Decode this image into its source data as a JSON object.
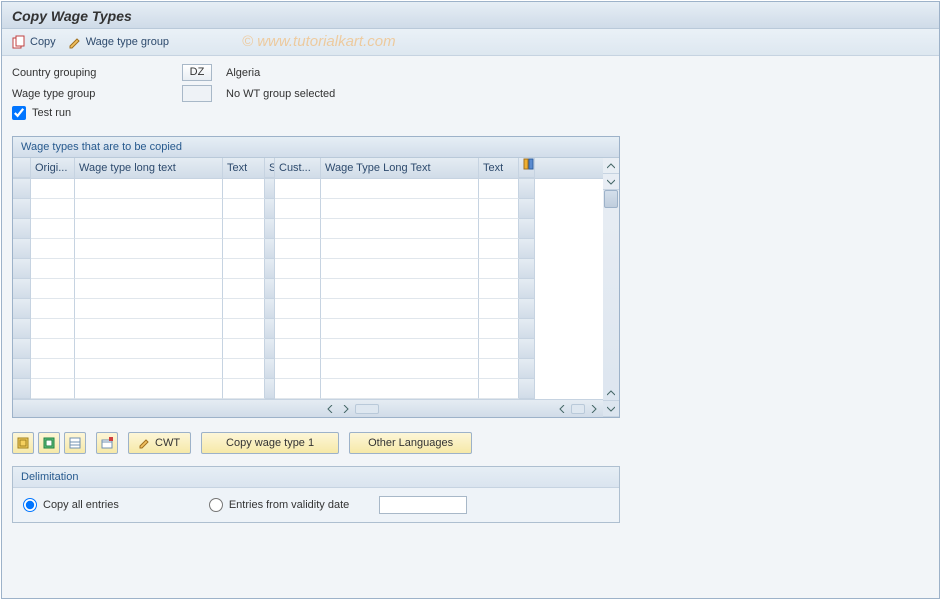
{
  "title": "Copy Wage Types",
  "toolbar": {
    "copy_label": "Copy",
    "wtg_label": "Wage type group"
  },
  "watermark": "©  www.tutorialkart.com",
  "form": {
    "country_grouping_label": "Country grouping",
    "country_grouping_value": "DZ",
    "country_grouping_desc": "Algeria",
    "wtg_label": "Wage type group",
    "wtg_value": "",
    "wtg_desc": "No WT group selected",
    "test_run_label": "Test run",
    "test_run_checked": true
  },
  "grid": {
    "title": "Wage types that are to be copied",
    "columns": [
      "Origi...",
      "Wage type long text",
      "Text",
      "S",
      "Cust...",
      "Wage Type Long Text",
      "Text"
    ],
    "row_count": 11
  },
  "buttons": {
    "cwt_label": "CWT",
    "copy_wt1_label": "Copy wage type 1",
    "other_lang_label": "Other Languages"
  },
  "delimitation": {
    "legend": "Delimitation",
    "radio_all_label": "Copy all entries",
    "radio_from_label": "Entries from validity date",
    "date_value": ""
  }
}
